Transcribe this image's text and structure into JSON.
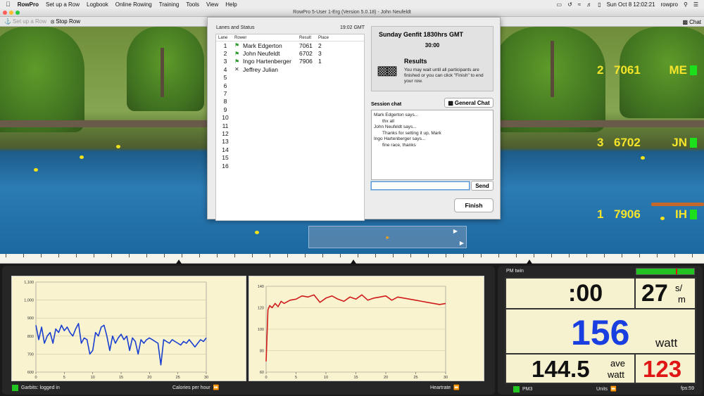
{
  "menubar": {
    "app_name": "RowPro",
    "items": [
      "Set up a Row",
      "Logbook",
      "Online Rowing",
      "Training",
      "Tools",
      "View",
      "Help"
    ],
    "clock": "Sun Oct 8  12:02:21",
    "user": "rowpro"
  },
  "window": {
    "title": "RowPro 5-User 1-Erg (Version 5.0.18) - John Neufeldt"
  },
  "toolbar": {
    "setup_label": "Set up a Row",
    "stop_label": "Stop Row",
    "chat_label": "Chat"
  },
  "scene": {
    "lanes": [
      {
        "place": "2",
        "result": "7061",
        "initials": "ME"
      },
      {
        "place": "3",
        "result": "6702",
        "initials": "JN"
      },
      {
        "place": "1",
        "result": "7906",
        "initials": "IH"
      }
    ]
  },
  "dialog": {
    "lanes_title": "Lanes and Status",
    "gmt_time": "19:02 GMT",
    "headers": {
      "lane": "Lane",
      "rower": "Rower",
      "result": "Result",
      "place": "Place"
    },
    "rows": [
      {
        "lane": "1",
        "status": "finished",
        "rower": "Mark Edgerton",
        "result": "7061",
        "place": "2"
      },
      {
        "lane": "2",
        "status": "finished",
        "rower": "John Neufeldt",
        "result": "6702",
        "place": "3"
      },
      {
        "lane": "3",
        "status": "finished",
        "rower": "Ingo Hartenberger",
        "result": "7906",
        "place": "1"
      },
      {
        "lane": "4",
        "status": "dropped",
        "rower": "Jeffrey Julian",
        "result": "",
        "place": ""
      },
      {
        "lane": "5",
        "status": "",
        "rower": "",
        "result": "",
        "place": ""
      },
      {
        "lane": "6",
        "status": "",
        "rower": "",
        "result": "",
        "place": ""
      },
      {
        "lane": "7",
        "status": "",
        "rower": "",
        "result": "",
        "place": ""
      },
      {
        "lane": "8",
        "status": "",
        "rower": "",
        "result": "",
        "place": ""
      },
      {
        "lane": "9",
        "status": "",
        "rower": "",
        "result": "",
        "place": ""
      },
      {
        "lane": "10",
        "status": "",
        "rower": "",
        "result": "",
        "place": ""
      },
      {
        "lane": "11",
        "status": "",
        "rower": "",
        "result": "",
        "place": ""
      },
      {
        "lane": "12",
        "status": "",
        "rower": "",
        "result": "",
        "place": ""
      },
      {
        "lane": "13",
        "status": "",
        "rower": "",
        "result": "",
        "place": ""
      },
      {
        "lane": "14",
        "status": "",
        "rower": "",
        "result": "",
        "place": ""
      },
      {
        "lane": "15",
        "status": "",
        "rower": "",
        "result": "",
        "place": ""
      },
      {
        "lane": "16",
        "status": "",
        "rower": "",
        "result": "",
        "place": ""
      }
    ],
    "event_title": "Sunday Genfit 1830hrs GMT",
    "event_duration": "30:00",
    "results_title": "Results",
    "results_message": "You may wait until all participants are finished or you can click \"Finish\" to end your row.",
    "session_chat_label": "Session chat",
    "general_chat_label": "General Chat",
    "chat_messages": [
      {
        "who": "Mark Edgerton says...",
        "text": "thx all"
      },
      {
        "who": "John Neufeldt says...",
        "text": "Thanks for setting it up, Mark"
      },
      {
        "who": "Ingo Hartenberger says...",
        "text": "fine race, thanks"
      }
    ],
    "chat_input_value": "",
    "send_label": "Send",
    "finish_label": "Finish"
  },
  "graphs": {
    "left_footer_status": "Garbits: logged in",
    "left_footer_label": "Calories per hour",
    "right_footer_label": "Heartrate"
  },
  "pm": {
    "title": "PM twin",
    "time": ":00",
    "stroke_rate": "27",
    "stroke_rate_unit_top": "s/",
    "stroke_rate_unit_bottom": "m",
    "watts": "156",
    "watts_unit": "watt",
    "ave_watts": "144.5",
    "ave_label_top": "ave",
    "ave_label_bottom": "watt",
    "heart_rate": "123",
    "monitor_label": "PM3",
    "units_label": "Units",
    "fps": "fps:59",
    "colors": {
      "watts": "#1a3fe0",
      "heart_rate": "#e01515"
    }
  },
  "chart_data": [
    {
      "type": "line",
      "title": "Calories per hour",
      "xlabel": "",
      "ylabel": "",
      "xlim": [
        0,
        30
      ],
      "ylim": [
        600,
        1100
      ],
      "x_ticks": [
        "0",
        "5",
        "10",
        "15",
        "20",
        "25",
        "30"
      ],
      "y_ticks": [
        "600",
        "700",
        "800",
        "900",
        "1,000",
        "1,100"
      ],
      "color": "#1a3fd0",
      "series": [
        {
          "x": [
            0,
            0.5,
            1,
            1.5,
            2,
            2.5,
            3,
            3.5,
            4,
            4.5,
            5,
            5.5,
            6,
            6.5,
            7,
            7.5,
            8,
            8.5,
            9,
            9.5,
            10,
            10.5,
            11,
            11.5,
            12,
            12.5,
            13,
            13.5,
            14,
            14.5,
            15,
            15.5,
            16,
            16.5,
            17,
            17.5,
            18,
            18.5,
            19,
            19.5,
            20,
            20.5,
            21,
            21.5,
            22,
            22.5,
            23,
            23.5,
            24,
            24.5,
            25,
            25.5,
            26,
            26.5,
            27,
            27.5,
            28,
            28.5,
            29,
            29.5,
            30
          ],
          "y": [
            860,
            780,
            850,
            760,
            800,
            820,
            760,
            840,
            820,
            860,
            830,
            850,
            820,
            800,
            840,
            870,
            760,
            790,
            780,
            700,
            720,
            820,
            800,
            850,
            860,
            800,
            720,
            800,
            760,
            790,
            810,
            780,
            800,
            720,
            790,
            770,
            700,
            780,
            760,
            780,
            790,
            780,
            770,
            760,
            640,
            780,
            770,
            760,
            780,
            770,
            760,
            750,
            770,
            760,
            780,
            760,
            740,
            760,
            780,
            770,
            790
          ]
        }
      ]
    },
    {
      "type": "line",
      "title": "Heartrate",
      "xlabel": "",
      "ylabel": "",
      "xlim": [
        0,
        30
      ],
      "ylim": [
        60,
        140
      ],
      "x_ticks": [
        "0",
        "5",
        "10",
        "15",
        "20",
        "25",
        "30"
      ],
      "y_ticks": [
        "60",
        "80",
        "100",
        "120",
        "140"
      ],
      "color": "#d01b1b",
      "series": [
        {
          "x": [
            0,
            0.3,
            0.6,
            1,
            1.5,
            2,
            2.5,
            3,
            4,
            5,
            6,
            7,
            8,
            9,
            10,
            11,
            12,
            13,
            14,
            15,
            16,
            17,
            18,
            19,
            20,
            21,
            22,
            23,
            24,
            25,
            26,
            27,
            28,
            29,
            30
          ],
          "y": [
            70,
            118,
            122,
            120,
            124,
            121,
            126,
            124,
            127,
            128,
            131,
            130,
            132,
            125,
            129,
            131,
            128,
            126,
            130,
            128,
            132,
            127,
            129,
            130,
            131,
            127,
            130,
            129,
            128,
            127,
            126,
            125,
            124,
            123,
            124
          ]
        }
      ]
    }
  ]
}
